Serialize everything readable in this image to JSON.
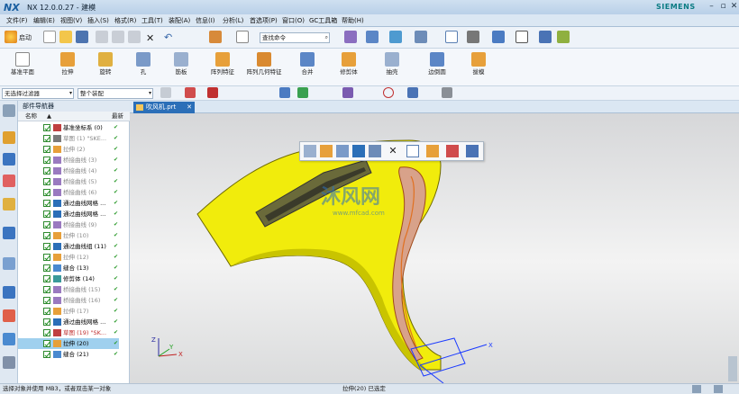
{
  "window": {
    "logo": "NX",
    "title": "NX 12.0.0.27 - 建模",
    "brand": "SIEMENS"
  },
  "menu": [
    "文件(F)",
    "编辑(E)",
    "视图(V)",
    "插入(S)",
    "格式(R)",
    "工具(T)",
    "装配(A)",
    "信息(I)",
    "分析(L)",
    "首选项(P)",
    "窗口(O)",
    "GC工具箱",
    "帮助(H)"
  ],
  "toolbar": {
    "start_label": "启动",
    "search_placeholder": "查找命令"
  },
  "ribbon": [
    "基准平面",
    "拉伸",
    "旋转",
    "孔",
    "筋板",
    "阵列特征",
    "阵列几何特征",
    "合并",
    "修剪体",
    "抽壳",
    "边倒圆",
    "拔模"
  ],
  "filters": {
    "type_filter": "无选择过滤器",
    "scope_filter": "整个装配"
  },
  "navigator": {
    "title": "部件导航器",
    "col_name": "名称",
    "col_latest": "最新",
    "rows": [
      {
        "label": "基准坐标系 (0)",
        "color": "#000"
      },
      {
        "label": "草图 (1) \"SKE...",
        "color": "#888"
      },
      {
        "label": "拉伸 (2)",
        "color": "#888"
      },
      {
        "label": "桥接曲线 (3)",
        "color": "#888"
      },
      {
        "label": "桥接曲线 (4)",
        "color": "#888"
      },
      {
        "label": "桥接曲线 (5)",
        "color": "#888"
      },
      {
        "label": "桥接曲线 (6)",
        "color": "#888"
      },
      {
        "label": "通过曲线网格 ...",
        "color": "#000"
      },
      {
        "label": "通过曲线网格 ...",
        "color": "#000"
      },
      {
        "label": "桥接曲线 (9)",
        "color": "#888"
      },
      {
        "label": "拉伸 (10)",
        "color": "#888"
      },
      {
        "label": "通过曲线组 (11)",
        "color": "#000"
      },
      {
        "label": "拉伸 (12)",
        "color": "#888"
      },
      {
        "label": "缝合 (13)",
        "color": "#000"
      },
      {
        "label": "修剪体 (14)",
        "color": "#000"
      },
      {
        "label": "桥接曲线 (15)",
        "color": "#888"
      },
      {
        "label": "桥接曲线 (16)",
        "color": "#888"
      },
      {
        "label": "拉伸 (17)",
        "color": "#888"
      },
      {
        "label": "通过曲线网格 ...",
        "color": "#000"
      },
      {
        "label": "草图 (19) \"SK...",
        "color": "#c03030"
      },
      {
        "label": "拉伸 (20)",
        "color": "#000"
      },
      {
        "label": "缝合 (21)",
        "color": "#000"
      }
    ],
    "selected_index": 20
  },
  "viewport": {
    "tab_label": "吹风机.prt",
    "axis_x": "X",
    "axis_y": "Y",
    "axis_z": "Z",
    "watermark_main": "沐风网",
    "watermark_sub": "www.mfcad.com"
  },
  "status": {
    "left": "选择对象并使用 MB3，或者双击某一对象",
    "center": "拉伸(20) 已选定"
  },
  "colors": {
    "accent": "#2b6fb8",
    "model": "#f2ee10"
  }
}
